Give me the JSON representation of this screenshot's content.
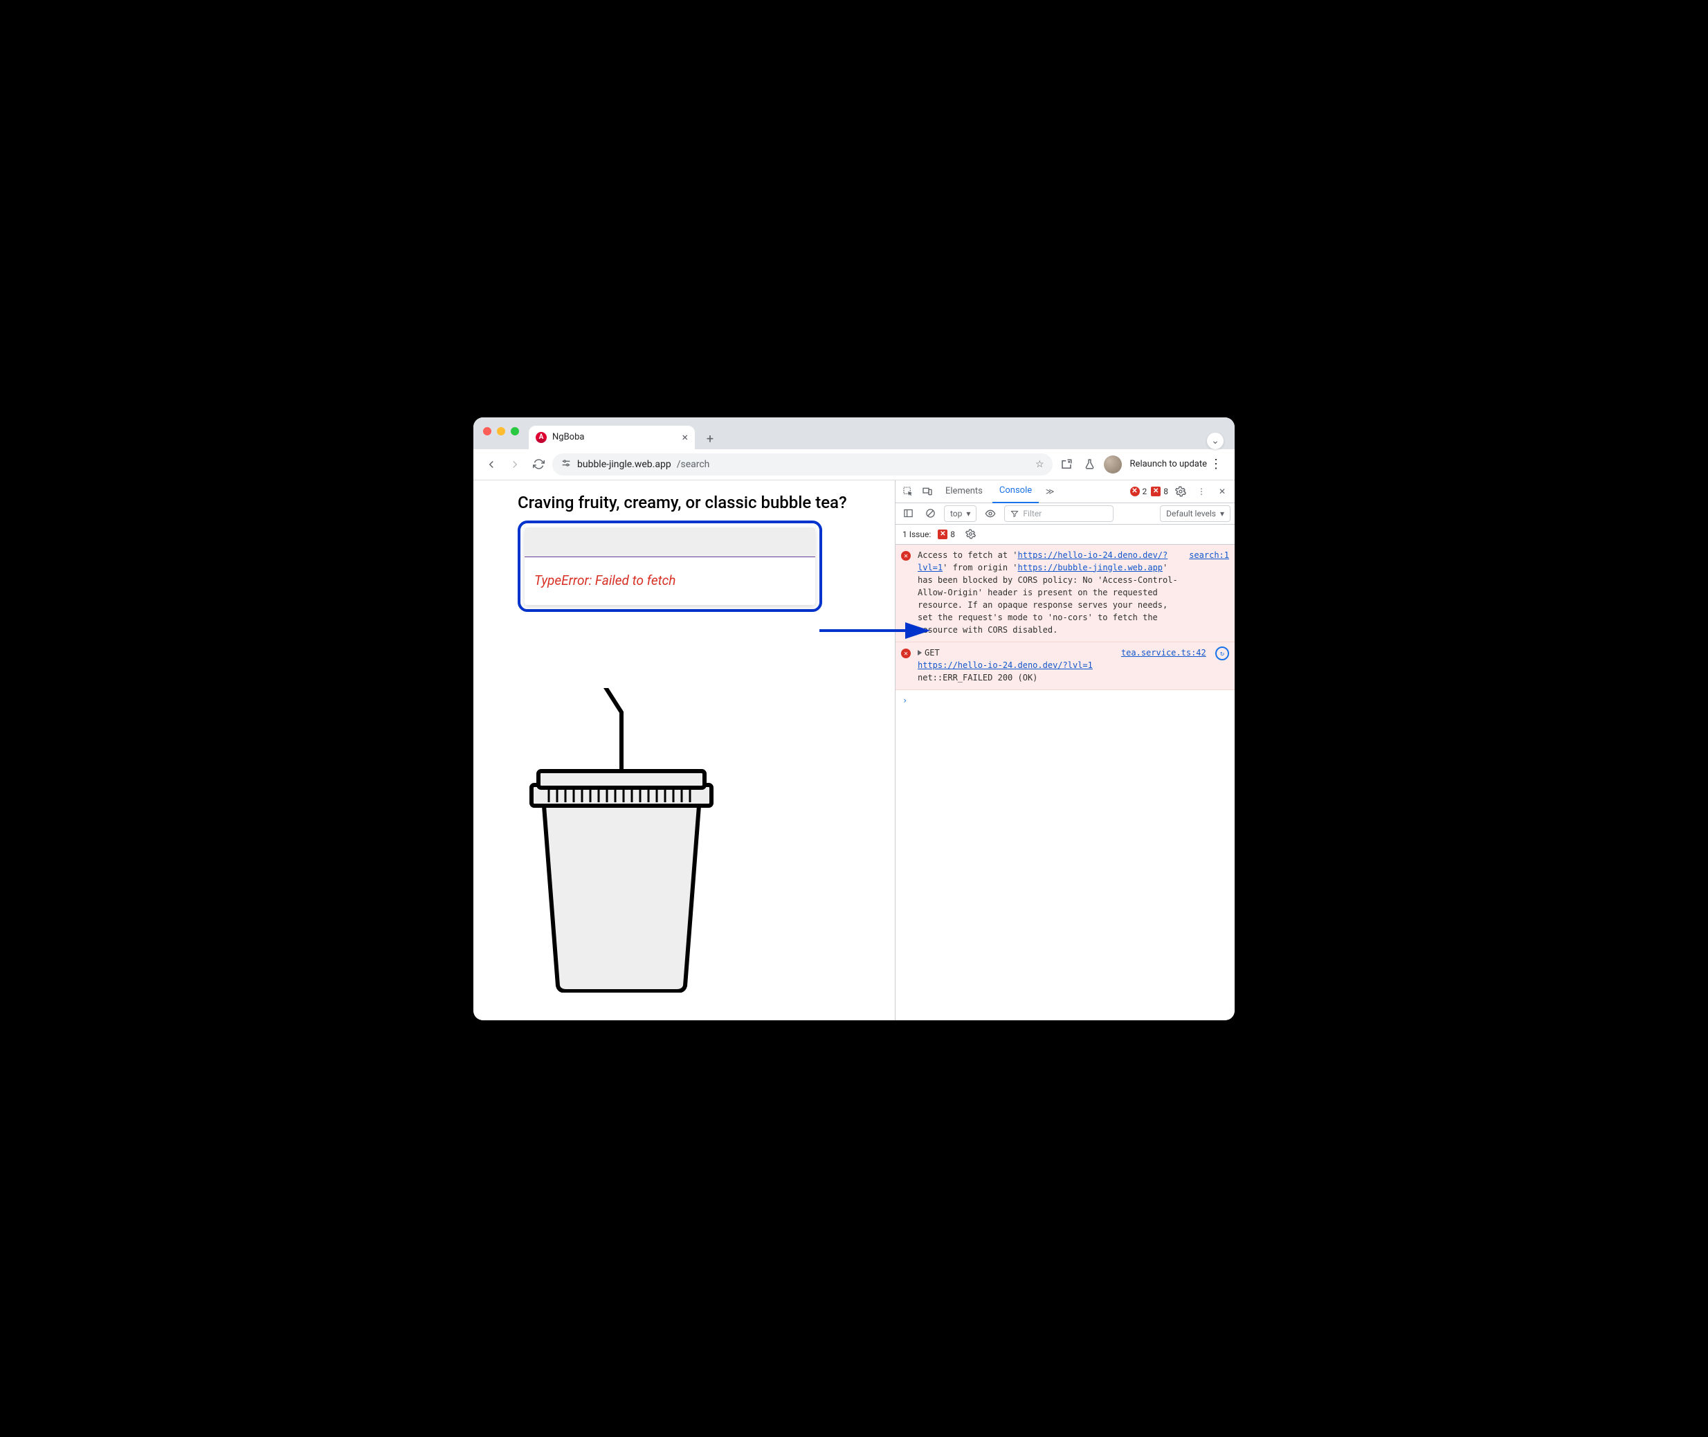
{
  "browser": {
    "tab_title": "NgBoba",
    "url_host": "bubble-jingle.web.app",
    "url_path": "/search",
    "relaunch": "Relaunch to update"
  },
  "page": {
    "heading": "Craving fruity, creamy, or classic bubble tea?",
    "error": "TypeError: Failed to fetch"
  },
  "devtools": {
    "tabs": {
      "elements": "Elements",
      "console": "Console"
    },
    "err_count": "2",
    "warn_count": "8",
    "context": "top",
    "filter_placeholder": "Filter",
    "levels": "Default levels",
    "issues_label": "1 Issue:",
    "issues_count": "8",
    "logs": [
      {
        "source": "search:1",
        "pre": "Access to fetch at '",
        "url1": "https://hello-io-24.deno.dev/?lvl=1",
        "mid": "' from origin '",
        "url2": "https://bubble-jingle.web.app",
        "post": "' has been blocked by CORS policy: No 'Access-Control-Allow-Origin' header is present on the requested resource. If an opaque response serves your needs, set the request's mode to 'no-cors' to fetch the resource with CORS disabled."
      },
      {
        "source": "tea.service.ts:42",
        "method": "GET",
        "url": "https://hello-io-24.deno.dev/?lvl=1",
        "tail": " net::ERR_FAILED 200 (OK)"
      }
    ]
  }
}
